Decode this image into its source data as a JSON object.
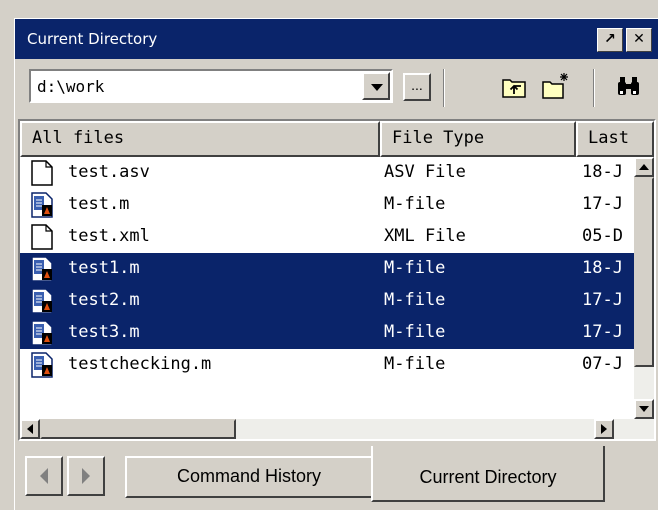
{
  "window": {
    "title": "Current Directory",
    "buttons": [
      {
        "icon": "undock-arrow-icon",
        "glyph": "↗"
      },
      {
        "icon": "close-icon",
        "glyph": "✕"
      }
    ]
  },
  "toolbar": {
    "path_value": "d:\\work",
    "browse_label": "...",
    "icons": [
      "up-folder-icon",
      "new-folder-icon",
      "find-binoculars-icon"
    ]
  },
  "table": {
    "columns": [
      "All files",
      "File Type",
      "Last"
    ],
    "rows": [
      {
        "name": "test.asv",
        "type": "ASV File",
        "last": "18-J",
        "icon": "document-icon",
        "selected": false
      },
      {
        "name": "test.m",
        "type": "M-file",
        "last": "17-J",
        "icon": "m-file-icon",
        "selected": false
      },
      {
        "name": "test.xml",
        "type": "XML File",
        "last": "05-D",
        "icon": "document-icon",
        "selected": false
      },
      {
        "name": "test1.m",
        "type": "M-file",
        "last": "18-J",
        "icon": "m-file-icon",
        "selected": true
      },
      {
        "name": "test2.m",
        "type": "M-file",
        "last": "17-J",
        "icon": "m-file-icon",
        "selected": true
      },
      {
        "name": "test3.m",
        "type": "M-file",
        "last": "17-J",
        "icon": "m-file-icon",
        "selected": true
      },
      {
        "name": "testchecking.m",
        "type": "M-file",
        "last": "07-J",
        "icon": "m-file-icon",
        "selected": false
      }
    ]
  },
  "tabs": {
    "items": [
      "Command History",
      "Current Directory"
    ],
    "active": "Current Directory"
  },
  "colors": {
    "title_bar": "#0a246a",
    "selection": "#0a246a",
    "face": "#d4d0c8"
  }
}
